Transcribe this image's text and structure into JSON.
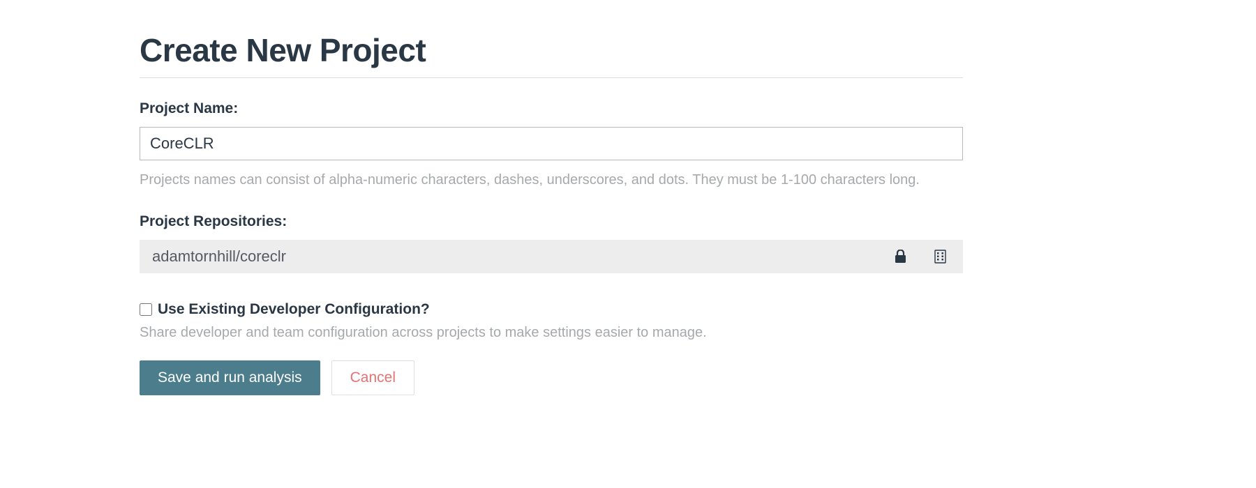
{
  "page": {
    "title": "Create New Project"
  },
  "project_name": {
    "label": "Project Name:",
    "value": "CoreCLR",
    "help": "Projects names can consist of alpha-numeric characters, dashes, underscores, and dots. They must be 1-100 characters long."
  },
  "repositories": {
    "label": "Project Repositories:",
    "items": [
      {
        "name": "adamtornhill/coreclr"
      }
    ]
  },
  "dev_config": {
    "checkbox_label": "Use Existing Developer Configuration?",
    "checked": false,
    "help": "Share developer and team configuration across projects to make settings easier to manage."
  },
  "actions": {
    "save_label": "Save and run analysis",
    "cancel_label": "Cancel"
  }
}
